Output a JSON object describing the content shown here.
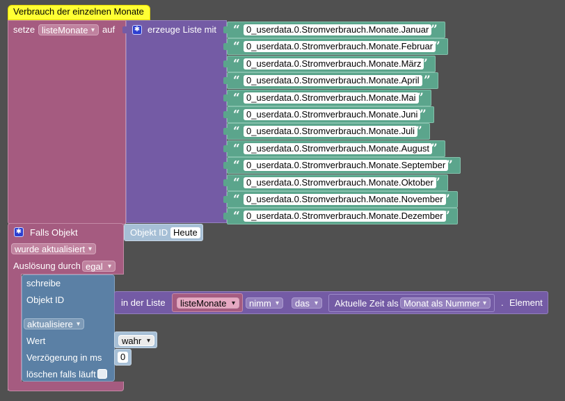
{
  "comment": "Verbrauch der einzelnen Monate",
  "setze": {
    "label": "setze",
    "variable": "listeMonate",
    "auf": "auf"
  },
  "create_list": {
    "label": "erzeuge Liste mit",
    "items": [
      "0_userdata.0.Stromverbrauch.Monate.Januar",
      "0_userdata.0.Stromverbrauch.Monate.Februar",
      "0_userdata.0.Stromverbrauch.Monate.März",
      "0_userdata.0.Stromverbrauch.Monate.April",
      "0_userdata.0.Stromverbrauch.Monate.Mai",
      "0_userdata.0.Stromverbrauch.Monate.Juni",
      "0_userdata.0.Stromverbrauch.Monate.Juli",
      "0_userdata.0.Stromverbrauch.Monate.August",
      "0_userdata.0.Stromverbrauch.Monate.September",
      "0_userdata.0.Stromverbrauch.Monate.Oktober",
      "0_userdata.0.Stromverbrauch.Monate.November",
      "0_userdata.0.Stromverbrauch.Monate.Dezember"
    ],
    "quote_open": "“",
    "quote_close": "”"
  },
  "trigger": {
    "label": "Falls Objekt",
    "object_id_label": "Objekt ID",
    "object_id_value": "Heute",
    "event": "wurde aktualisiert",
    "trigger_by_label": "Auslösung durch",
    "trigger_by_value": "egal"
  },
  "write": {
    "label": "schreibe",
    "object_id_label": "Objekt ID",
    "mode": "aktualisiere",
    "value_label": "Wert",
    "value": "wahr",
    "delay_label": "Verzögerung in ms",
    "delay": "0",
    "clear_label": "löschen falls läuft"
  },
  "list_get": {
    "prefix": "in der Liste",
    "variable": "listeMonate",
    "op": "nimm",
    "which": "das",
    "time_label": "Aktuelle Zeit als",
    "time_format": "Monat als Nummer",
    "dot": ".",
    "suffix": "Element"
  }
}
